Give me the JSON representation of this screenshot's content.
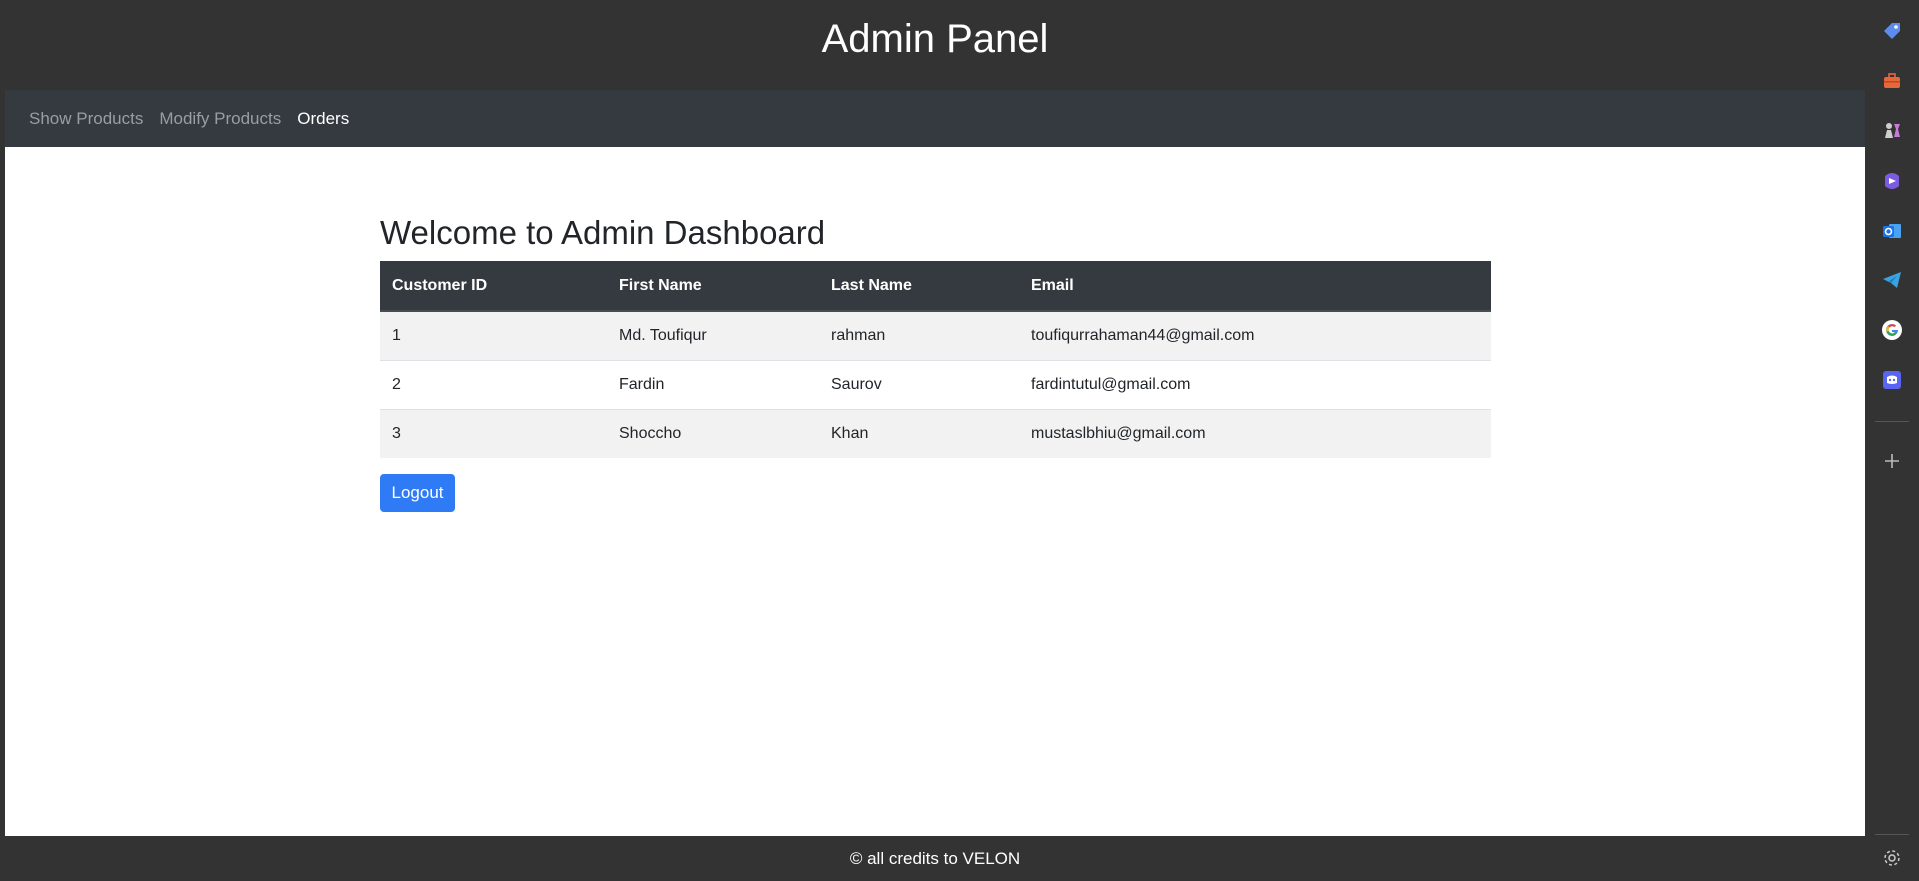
{
  "header": {
    "title": "Admin Panel"
  },
  "nav": {
    "items": [
      {
        "label": "Show Products",
        "active": false
      },
      {
        "label": "Modify Products",
        "active": false
      },
      {
        "label": "Orders",
        "active": true
      }
    ]
  },
  "main": {
    "heading": "Welcome to Admin Dashboard",
    "table": {
      "columns": [
        "Customer ID",
        "First Name",
        "Last Name",
        "Email"
      ],
      "rows": [
        [
          "1",
          "Md. Toufiqur",
          "rahman",
          "toufiqurrahaman44@gmail.com"
        ],
        [
          "2",
          "Fardin",
          "Saurov",
          "fardintutul@gmail.com"
        ],
        [
          "3",
          "Shoccho",
          "Khan",
          "mustaslbhiu@gmail.com"
        ]
      ]
    },
    "logout_label": "Logout"
  },
  "footer": {
    "text": "© all credits to VELON"
  },
  "sidebar": {
    "icons": [
      "tag-icon",
      "toolbox-icon",
      "chess-icon",
      "copilot-icon",
      "outlook-icon",
      "telegram-icon",
      "google-icon",
      "discord-icon",
      "add-icon",
      "settings-icon"
    ],
    "colors": {
      "tag": "#5b8def",
      "toolbox": "#e8673a",
      "copilot": "#7b5ce0",
      "outlook": "#1a73e8",
      "telegram": "#3aa3e3",
      "discord": "#5865f2"
    }
  }
}
